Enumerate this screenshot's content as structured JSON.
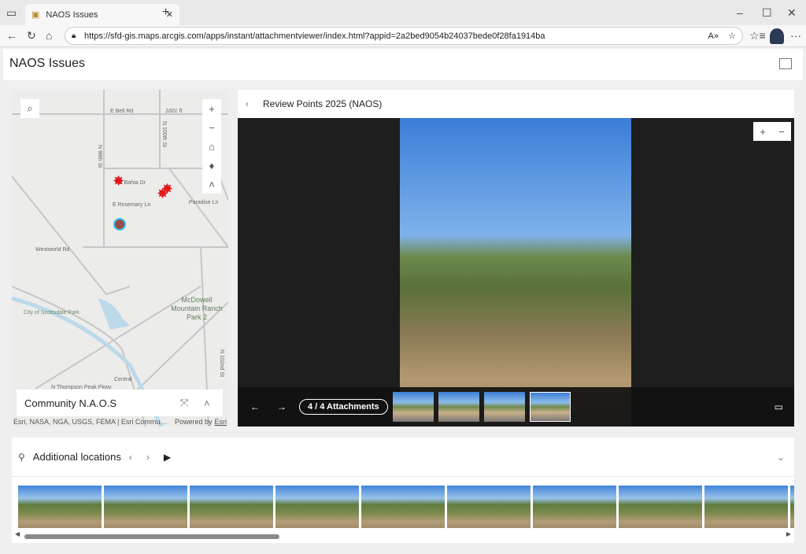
{
  "browser": {
    "tab_title": "NAOS Issues",
    "url": "https://sfd-gis.maps.arcgis.com/apps/instant/attachmentviewer/index.html?appid=2a2bed9054b24037bede0f28fa1914ba"
  },
  "app": {
    "title": "NAOS Issues"
  },
  "map": {
    "labels": {
      "bell": "E Bell Rd",
      "f1601": "1601 ft",
      "n98": "N 98th St",
      "n100": "N 100th St",
      "bahia": "E Bahia Dr",
      "rosemary": "E Rosemary Ln",
      "paradise": "Paradise Ln",
      "westworld": "Westworld Rd",
      "mcdowell": "McDowell Mountain Ranch Park 2",
      "scottsdale": "City of Scottsdale Park",
      "thompson": "N Thompson Peak Pkwy",
      "central": "Central",
      "n102": "N 102nd St"
    },
    "legend_title": "Community N.A.O.S",
    "attribution": "Esri, NASA, NGA, USGS, FEMA | Esri Community ...",
    "powered_by": "Powered by",
    "esri": "Esri",
    "marker_color": "#e31a1a",
    "selected_color": "#35c6e8"
  },
  "viewer": {
    "title": "Review Points 2025 (NAOS)",
    "attachment_count": "4 / 4 Attachments",
    "prev": "←",
    "next": "→"
  },
  "additional": {
    "title": "Additional locations"
  }
}
